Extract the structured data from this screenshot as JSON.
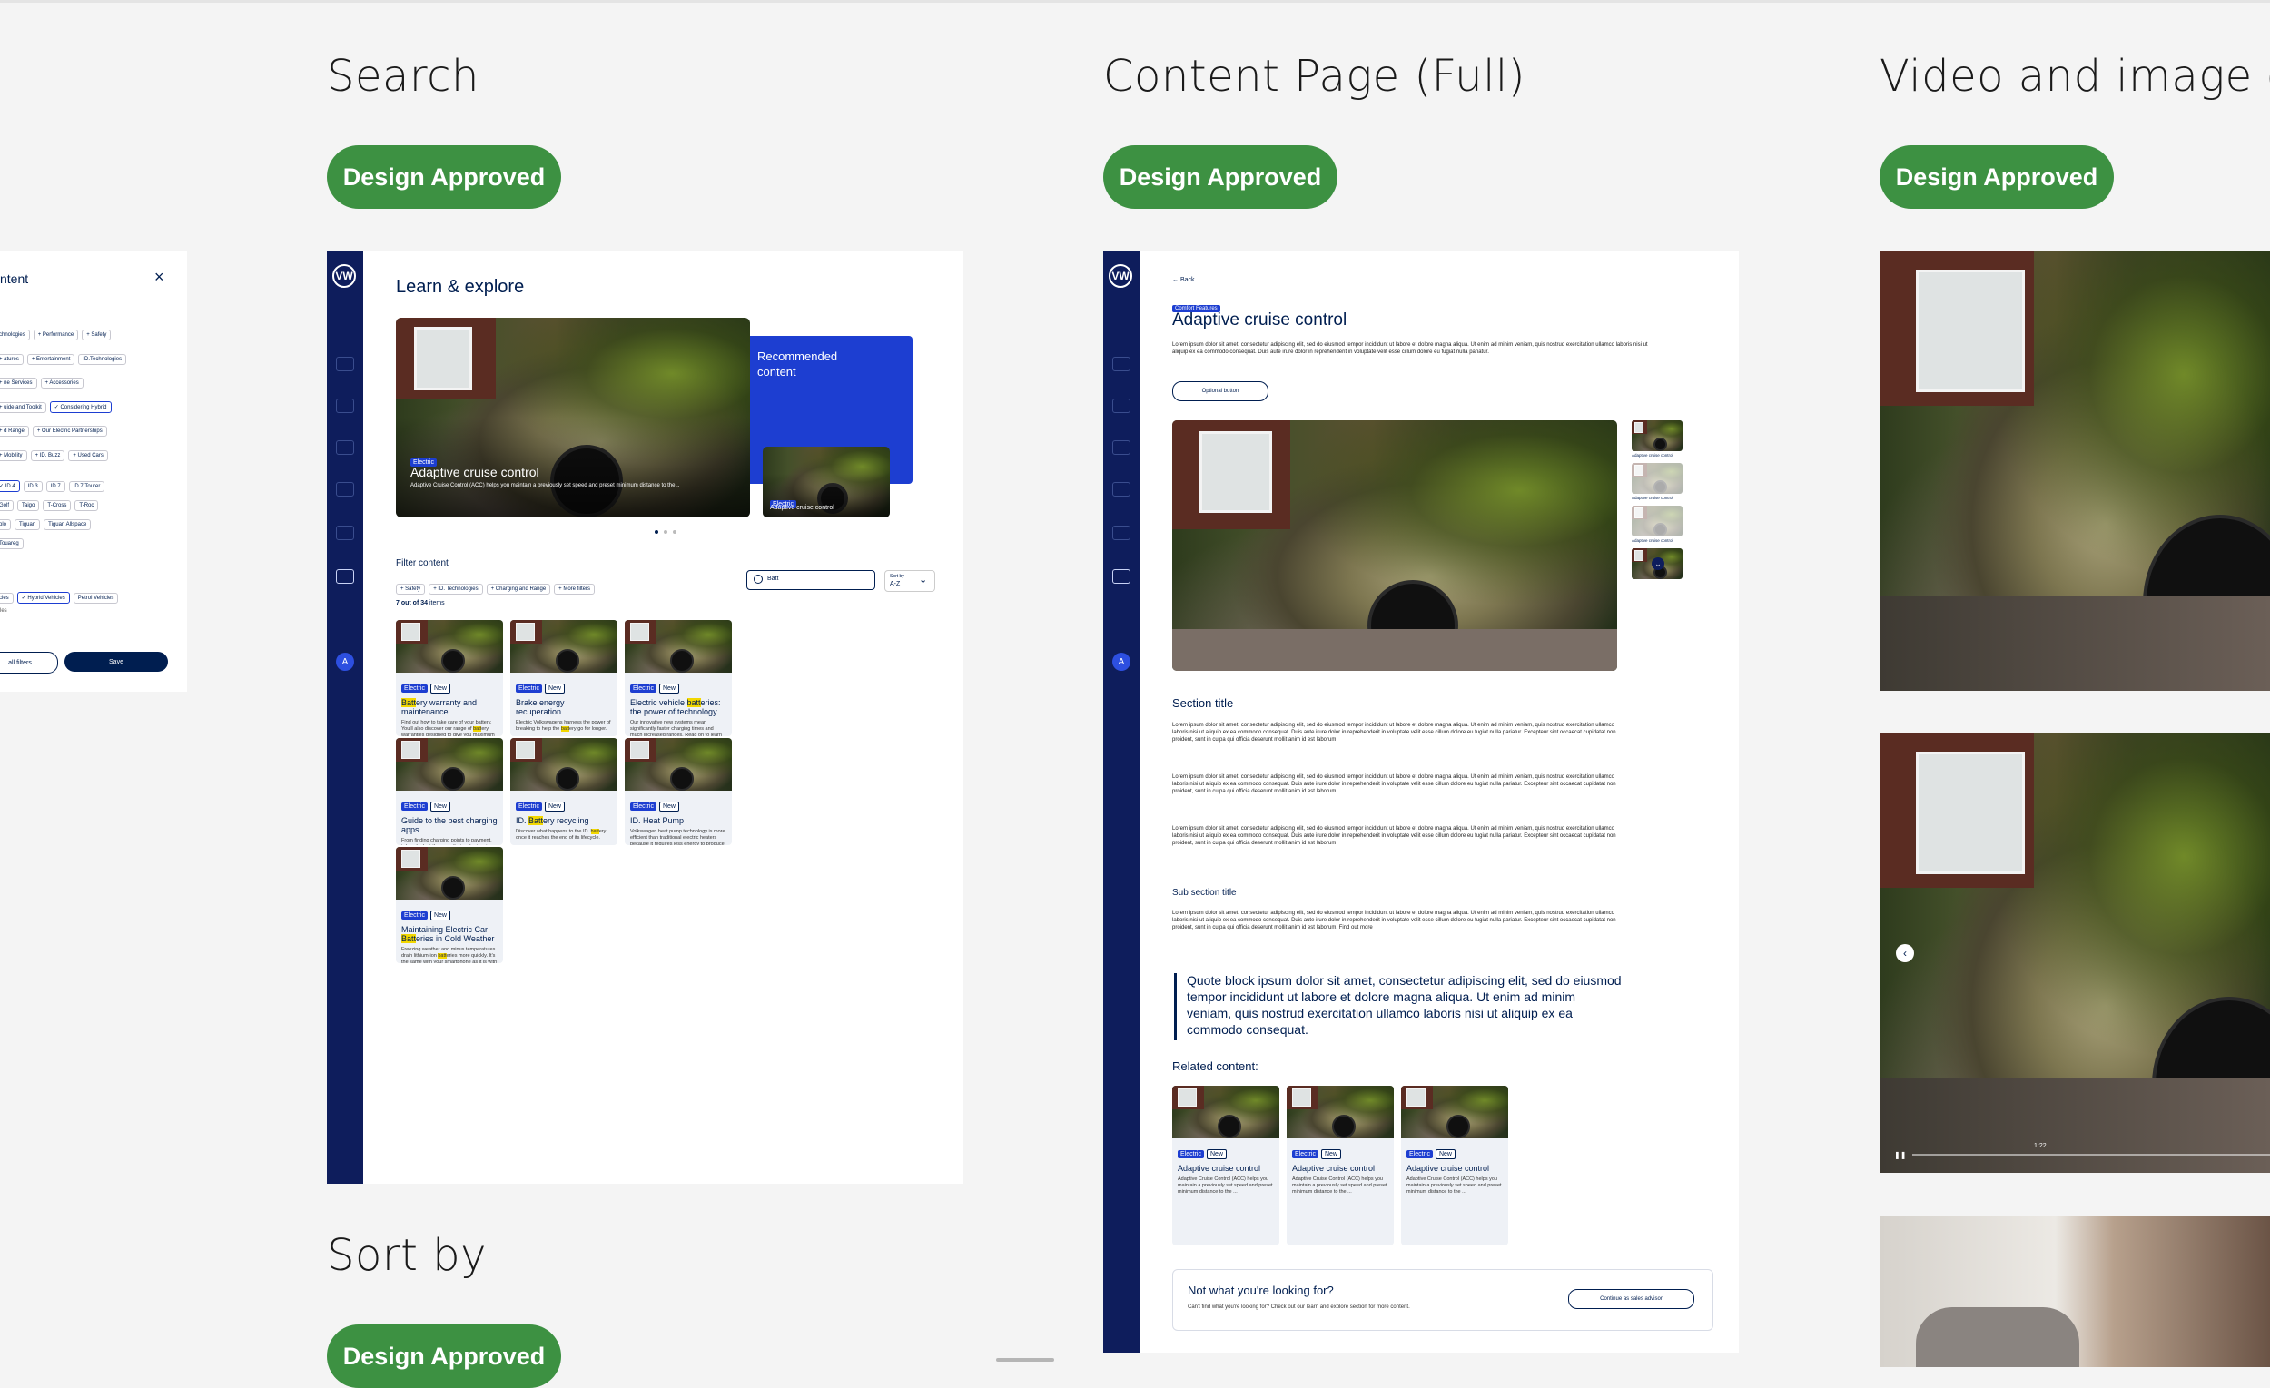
{
  "columns": {
    "search": {
      "title": "Search",
      "badge": "Design Approved"
    },
    "content_page": {
      "title": "Content Page (Full)",
      "badge": "Design Approved"
    },
    "video": {
      "title": "Video and image car",
      "badge": "Design Approved"
    },
    "sort": {
      "title": "Sort by",
      "badge": "Design Approved"
    }
  },
  "filter_panel": {
    "title": "ntent",
    "chip_rows": [
      [
        "chnologies",
        "Performance",
        "Safety"
      ],
      [
        "atures",
        "Entertainment",
        "ID.Technologies"
      ],
      [
        "ne Services",
        "Accessories"
      ],
      [
        "uide and Toolkit",
        "Considering Hybrid"
      ],
      [
        "d Range",
        "Our Electric Partnerships"
      ],
      [
        "Mobility",
        "ID. Buzz",
        "Used Cars"
      ]
    ],
    "model_rows": [
      [
        "ID.4",
        "ID.3",
        "ID.7",
        "ID.7 Tourer"
      ],
      [
        "Golf",
        "Taigo",
        "T-Cross",
        "T-Roc"
      ],
      [
        "olo",
        "Tiguan",
        "Tiguan Allspace"
      ],
      [
        "Touareg"
      ]
    ],
    "fuel_row": [
      "cles",
      "Hybrid Vehicles",
      "Petrol Vehicles"
    ],
    "extra": "les",
    "clear_label": "all filters",
    "save_label": "Save"
  },
  "search_page": {
    "heading": "Learn & explore",
    "hero_tag": "Electric",
    "hero_title": "Adaptive cruise control",
    "hero_desc": "Adaptive Cruise Control (ACC) helps you maintain a previously set speed and preset minimum distance to the...",
    "recommended": "Recommended content",
    "rec_tag": "Electric",
    "rec_title": "Adaptive cruise control",
    "filter_label": "Filter content",
    "filters": [
      "Safety",
      "ID. Technologies",
      "Charging and Range",
      "More filters"
    ],
    "search_value": "Batt",
    "sort_label": "Sort by",
    "sort_value": "A-Z",
    "count_bold": "7 out of 34",
    "count_rest": " items",
    "tag_electric": "Electric",
    "tag_new": "New",
    "cards": [
      {
        "t1": "",
        "hl": "Batt",
        "t2": "ery warranty and maintenance",
        "d1": "Find out how to take care of your battery. You'll also discover our range of ",
        "dhl": "batt",
        "d2": "ery warranties designed to give you maximum protection."
      },
      {
        "t1": "Brake energy recuperation",
        "hl": "",
        "t2": "",
        "d1": "Electric Volkswagens harness the power of breaking to help the ",
        "dhl": "batt",
        "d2": "ery go for longer."
      },
      {
        "t1": "Electric vehicle ",
        "hl": "batt",
        "t2": "eries: the power of technology",
        "d1": "Our innovative new systems mean significantly faster charging times and much increased ranges. Read on to learn more about the heart of your car.",
        "dhl": "",
        "d2": ""
      },
      {
        "t1": "Guide to the best charging apps",
        "hl": "",
        "t2": "",
        "d1": "From finding charging points to payment, take a look at the apps that make topping up your car's ",
        "dhl": "batt",
        "d2": "ery simple."
      },
      {
        "t1": "ID. ",
        "hl": "Batt",
        "t2": "ery recycling",
        "d1": "Discover what happens to the ID. ",
        "dhl": "batt",
        "d2": "ery once it reaches the end of its lifecycle."
      },
      {
        "t1": "ID. Heat Pump",
        "hl": "",
        "t2": "",
        "d1": "Volkswagen heat pump technology is more efficient than traditional electric heaters because it requires less energy to produce the same amount of heat. Addi",
        "dhl": "",
        "d2": ""
      },
      {
        "t1": "Maintaining Electric Car ",
        "hl": "Batt",
        "t2": "eries in Cold Weather",
        "d1": "Freezing weather and minus temperatures drain lithium-ion ",
        "dhl": "batt",
        "d2": "eries more quickly. It's the same with your smartphone as it is with your electric car. Why is..."
      }
    ]
  },
  "content_page": {
    "back": "Back",
    "category_tag": "Comfort Features",
    "title": "Adaptive cruise control",
    "intro": "Lorem ipsum dolor sit amet, consectetur adipiscing elit, sed do eiusmod tempor incididunt ut labore et dolore magna aliqua. Ut enim ad minim veniam, quis nostrud exercitation ullamco laboris nisi ut aliquip ex ea commodo consequat. Duis aute irure dolor in reprehenderit in voluptate velit esse cillum dolore eu fugiat nulla pariatur.",
    "optional_button": "Optional button",
    "thumb_caption": "Adaptive cruise control",
    "section_title": "Section title",
    "paragraph": "Lorem ipsum dolor sit amet, consectetur adipiscing elit, sed do eiusmod tempor incididunt ut labore et dolore magna aliqua. Ut enim ad minim veniam, quis nostrud exercitation ullamco laboris nisi ut aliquip ex ea commodo consequat. Duis aute irure dolor in reprehenderit in voluptate velit esse cillum dolore eu fugiat nulla pariatur. Excepteur sint occaecat cupidatat non proident, sunt in culpa qui officia deserunt mollit anim id est laborum",
    "sub_section_title": "Sub section title",
    "sub_paragraph": "Lorem ipsum dolor sit amet, consectetur adipiscing elit, sed do eiusmod tempor incididunt ut labore et dolore magna aliqua. Ut enim ad minim veniam, quis nostrud exercitation ullamco laboris nisi ut aliquip ex ea commodo consequat. Duis aute irure dolor in reprehenderit in voluptate velit esse cillum dolore eu fugiat nulla pariatur. Excepteur sint occaecat cupidatat non proident, sunt in culpa qui officia deserunt mollit anim id est laborum.",
    "find_out_more": "Find out more",
    "quote": "Quote block ipsum dolor sit amet, consectetur adipiscing elit, sed do eiusmod tempor incididunt ut labore et dolore magna aliqua. Ut enim ad minim veniam, quis nostrud exercitation ullamco laboris nisi ut aliquip ex ea commodo consequat.",
    "related_label": "Related content:",
    "related_title": "Adaptive cruise control",
    "related_desc": "Adaptive Cruise Control (ACC) helps you maintain a previously set speed and preset minimum distance to the ...",
    "not_found_title": "Not what you're looking for?",
    "not_found_desc": "Can't find what you're looking for? Check out our learn and explore section for more content.",
    "sales_button": "Continue as sales advisor"
  },
  "video_panel": {
    "time": "1:22"
  },
  "logo_text": "VW",
  "avatar_text": "A",
  "colors": {
    "badge": "#3d9142",
    "navy": "#0e1d5c",
    "accent": "#1d3ed1",
    "highlight": "#f2d700"
  }
}
